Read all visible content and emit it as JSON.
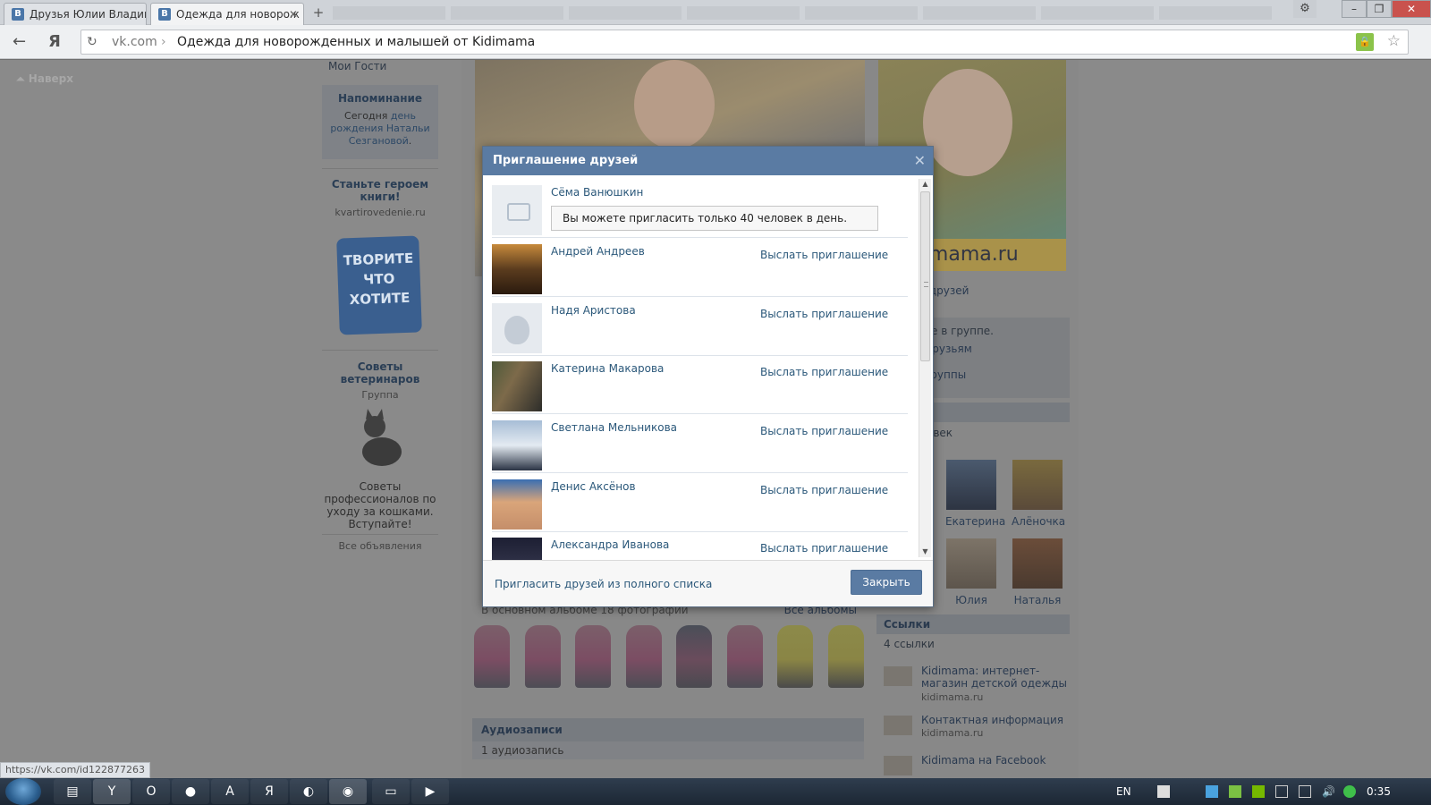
{
  "browser": {
    "tabs": [
      {
        "favicon": "В",
        "title": "Друзья Юлии Владим"
      },
      {
        "favicon": "В",
        "title": "Одежда для новорож"
      }
    ],
    "newtab_glyph": "+",
    "address": {
      "domain": "vk.com",
      "separator": "›",
      "page_title": "Одежда для новорожденных и малышей от Kidimama"
    },
    "status_url": "https://vk.com/id122877263"
  },
  "page": {
    "up_button": "Наверх",
    "left": {
      "guests": "Мои Гости",
      "reminder_title": "Напоминание",
      "reminder_line1": "Сегодня",
      "reminder_link1": "день рождения",
      "reminder_link2": "Натальи Сезгановой",
      "ad1_title": "Станьте героем книги!",
      "ad1_domain": "kvartirovedenie.ru",
      "ad1_logo": "ТВОРИТЕ ЧТО ХОТИТЕ",
      "ad2_title": "Советы ветеринаров",
      "ad2_sub": "Группа",
      "ad2_desc": "Советы профессионалов по уходу за кошками. Вступайте!",
      "all_ads": "Все объявления"
    },
    "side": {
      "hero_url": "kidimama.ru",
      "friends_frag": "ь друзей",
      "group_frag": "те в группе.",
      "friends_frag2": "друзьям",
      "group_frag2": "группы",
      "members_head_frag": "и",
      "members_count_frag": "овек",
      "members": [
        {
          "name": "Екатерина"
        },
        {
          "name": "Алёночка"
        },
        {
          "name": "Юлия"
        },
        {
          "name": "Наталья"
        }
      ],
      "links_head": "Ссылки",
      "links_count": "4 ссылки",
      "links": [
        {
          "title": "Kidimama: интернет-магазин детской одежды",
          "domain": "kidimama.ru"
        },
        {
          "title": "Контактная информация",
          "domain": "kidimama.ru"
        },
        {
          "title": "Kidimama на Facebook",
          "domain": ""
        }
      ]
    },
    "album": {
      "info": "В основном альбоме 18 фотографий",
      "all": "Все альбомы"
    },
    "audio": {
      "head": "Аудиозаписи",
      "count": "1 аудиозапись"
    }
  },
  "modal": {
    "title": "Приглашение друзей",
    "close_glyph": "✕",
    "notice": "Вы можете пригласить только 40 человек в день.",
    "invite_label": "Выслать приглашение",
    "friends": [
      {
        "name": "Сёма Ванюшкин",
        "avatar": "camera-placeholder",
        "invite": false
      },
      {
        "name": "Андрей Андреев",
        "avatar": "road-sunset",
        "invite": true
      },
      {
        "name": "Надя Аристова",
        "avatar": "dog-placeholder",
        "invite": true
      },
      {
        "name": "Катерина Макарова",
        "avatar": "couple-photo",
        "invite": true
      },
      {
        "name": "Светлана Мельникова",
        "avatar": "snow-photo",
        "invite": true
      },
      {
        "name": "Денис Аксёнов",
        "avatar": "boy-photo",
        "invite": true
      },
      {
        "name": "Александра Иванова",
        "avatar": "dark-photo",
        "invite": true
      }
    ],
    "footer_link": "Пригласить друзей из полного списка",
    "close_button": "Закрыть"
  },
  "taskbar": {
    "lang": "EN",
    "clock": "0:35"
  },
  "colors": {
    "vk_blue": "#5a7ba3",
    "link": "#2b587a"
  }
}
